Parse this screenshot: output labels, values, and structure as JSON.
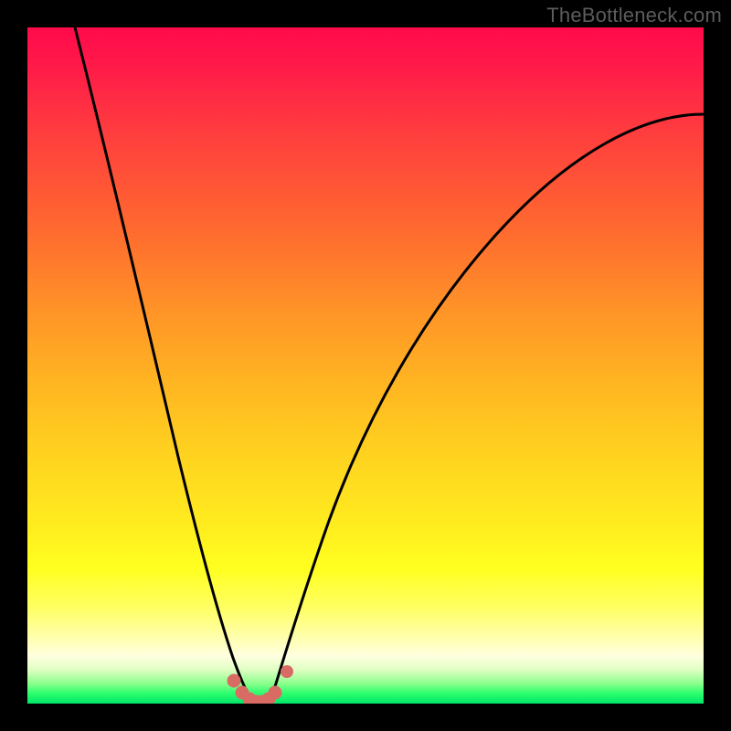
{
  "watermark": "TheBottleneck.com",
  "colors": {
    "frame": "#000000",
    "curve": "#000000",
    "marker": "#d96b65",
    "gradient_stops": [
      "#ff0a4a",
      "#ff1b49",
      "#ff3b3f",
      "#ff6a2f",
      "#ff9427",
      "#ffb322",
      "#ffd21f",
      "#ffe81f",
      "#ffff1f",
      "#ffff66",
      "#ffffaa",
      "#ffffe0",
      "#dfffc2",
      "#8dff8d",
      "#2bff6d",
      "#00e56a"
    ]
  },
  "chart_data": {
    "type": "line",
    "title": "",
    "xlabel": "",
    "ylabel": "",
    "xlim": [
      0,
      100
    ],
    "ylim": [
      0,
      100
    ],
    "grid": false,
    "series": [
      {
        "name": "left-curve",
        "x": [
          7,
          10,
          13,
          16,
          19,
          21,
          23,
          25,
          26.5,
          28,
          29.5,
          31,
          32,
          33
        ],
        "y": [
          100,
          83,
          67,
          52,
          40,
          31,
          23,
          16,
          12,
          8,
          5,
          3,
          1.5,
          0.5
        ]
      },
      {
        "name": "right-curve",
        "x": [
          36,
          37.5,
          39,
          41,
          44,
          48,
          53,
          59,
          66,
          74,
          83,
          92,
          100
        ],
        "y": [
          0.5,
          3,
          7,
          13,
          22,
          33,
          44,
          54,
          63,
          71,
          78,
          83,
          87
        ]
      }
    ],
    "markers": {
      "name": "bottom-markers",
      "x": [
        30.5,
        31.7,
        32.8,
        33.7,
        34.7,
        35.6,
        36.6,
        38.4
      ],
      "y": [
        3.4,
        1.6,
        0.7,
        0.3,
        0.3,
        0.7,
        1.6,
        4.8
      ]
    }
  }
}
